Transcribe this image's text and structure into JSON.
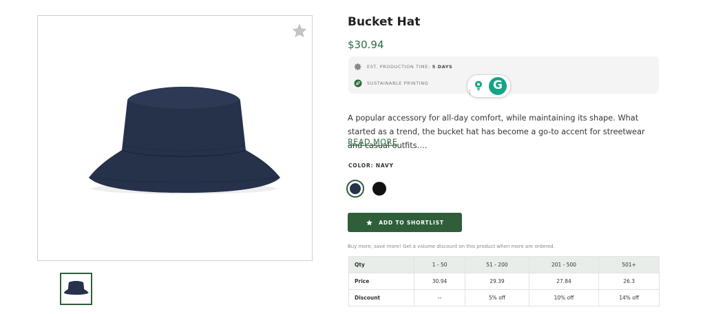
{
  "product": {
    "title": "Bucket Hat",
    "price": "$30.94",
    "info": {
      "production_label": "EST. PRODUCTION TIME:",
      "production_value": "5 DAYS",
      "sustainable_label": "SUSTAINABLE PRINTING"
    },
    "description": "A popular accessory for all-day comfort, while maintaining its shape. What started as a trend, the bucket hat has become a go-to accent for streetwear and casual outfits.…",
    "read_more": "READ MORE",
    "color_label": "COLOR: NAVY",
    "swatches": [
      {
        "name": "Navy",
        "hex": "#26314a",
        "selected": true
      },
      {
        "name": "Black",
        "hex": "#111111",
        "selected": false
      }
    ],
    "add_button": "ADD TO SHORTLIST",
    "volume_note": "Buy more, save more! Get a volume discount on this product when more are ordered."
  },
  "icons": {
    "favorite": "star-icon",
    "production": "gear-icon",
    "sustainable": "leaf-icon",
    "grammarly_suggest": "lightbulb-icon",
    "grammarly_logo": "grammarly-g-icon",
    "add": "star-icon"
  },
  "grammarly": {
    "logo_letter": "G"
  },
  "volume_table": {
    "headers": [
      "Qty",
      "1 - 50",
      "51 - 200",
      "201 - 500",
      "501+"
    ],
    "rows": [
      {
        "label": "Price",
        "values": [
          "30.94",
          "29.39",
          "27.84",
          "26.3"
        ]
      },
      {
        "label": "Discount",
        "values": [
          "--",
          "5% off",
          "10% off",
          "14% off"
        ]
      }
    ]
  },
  "colors": {
    "accent": "#2e5e3a",
    "price": "#2e6b3e",
    "hat": "#26314a",
    "table_header": "#e8ede9"
  }
}
